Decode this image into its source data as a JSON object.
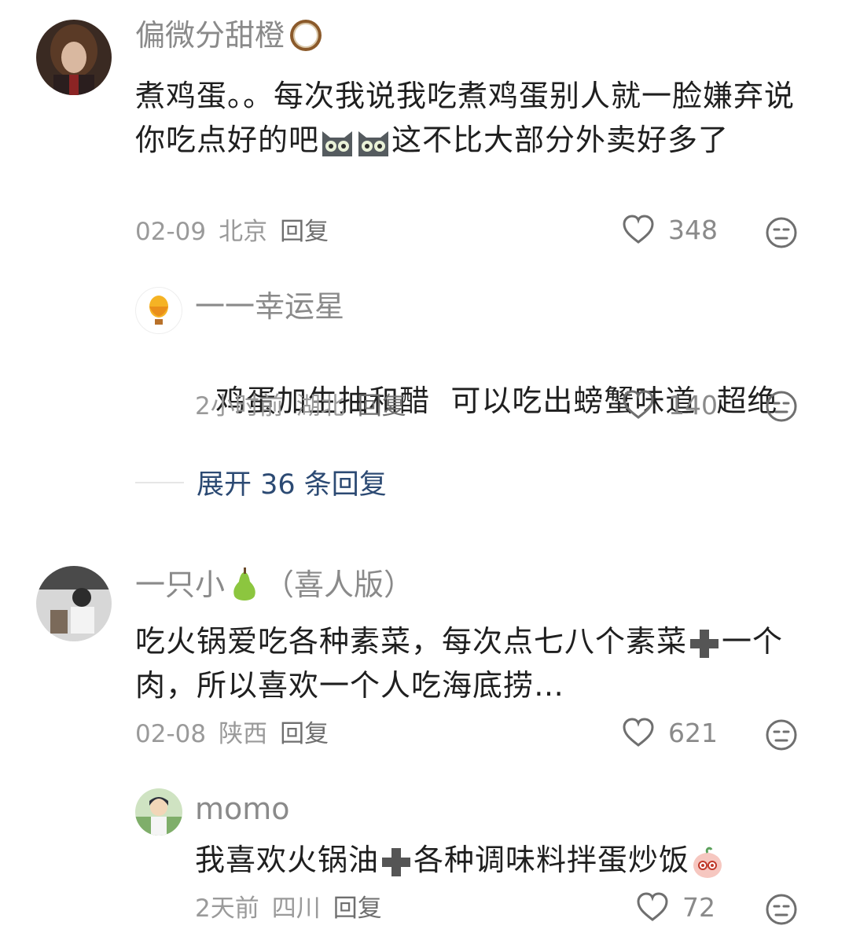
{
  "comments": [
    {
      "username": "偏微分甜橙",
      "username_emoji": "coconut-icon",
      "content_parts": [
        "煮鸡蛋。。每次我说我吃煮鸡蛋别人就一脸嫌弃说你吃点好的吧",
        "这不比大部分外卖好多了"
      ],
      "content_emoji": "cat-face-icon",
      "date": "02-09",
      "location": "北京",
      "reply_label": "回复",
      "likes": "348",
      "replies": [
        {
          "username": "一一幸运星",
          "content": "鸡蛋加生抽和醋  可以吃出螃蟹味道  超绝",
          "date": "2小时前",
          "location": "湖北",
          "reply_label": "回复",
          "likes": "140"
        }
      ],
      "expand_label": "展开 36 条回复"
    },
    {
      "username_prefix": "一只小",
      "username_emoji": "pear-icon",
      "username_suffix": "（喜人版）",
      "content_parts": [
        "吃火锅爱吃各种素菜，每次点七八个素菜",
        "一个肉，所以喜欢一个人吃海底捞…"
      ],
      "content_emoji": "plus-icon",
      "date": "02-08",
      "location": "陕西",
      "reply_label": "回复",
      "likes": "621",
      "replies": [
        {
          "username": "momo",
          "content_parts": [
            "我喜欢火锅油",
            "各种调味料拌蛋炒饭"
          ],
          "content_emoji": "plus-icon",
          "trailing_emoji": "peach-face-icon",
          "date": "2天前",
          "location": "四川",
          "reply_label": "回复",
          "likes": "72"
        }
      ]
    }
  ]
}
